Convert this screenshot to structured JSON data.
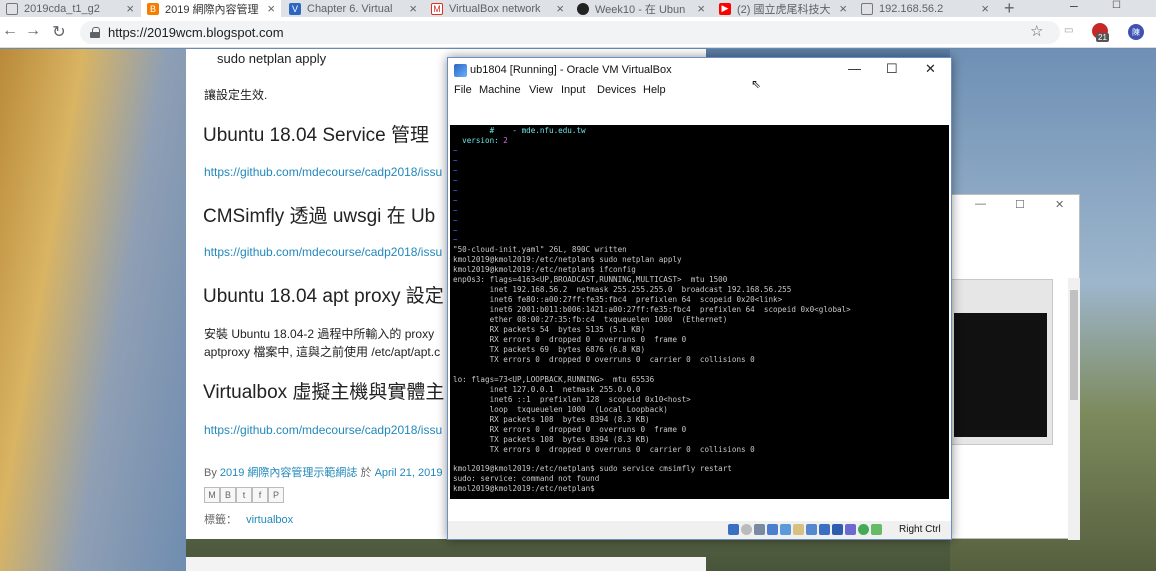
{
  "browser": {
    "tabs": [
      {
        "label": "2019cda_t1_g2",
        "icon": "doc-icon",
        "active": false
      },
      {
        "label": "2019 網際內容管理",
        "icon": "blogger-icon",
        "active": true
      },
      {
        "label": "Chapter 6. Virtual",
        "icon": "vbox-icon",
        "active": false
      },
      {
        "label": "VirtualBox network",
        "icon": "gmail-icon",
        "active": false
      },
      {
        "label": "Week10 - 在 Ubun",
        "icon": "github-icon",
        "active": false
      },
      {
        "label": "(2) 國立虎尾科技大",
        "icon": "youtube-icon",
        "active": false
      },
      {
        "label": "192.168.56.2",
        "icon": "doc-icon",
        "active": false
      }
    ],
    "url": "https://2019wcm.blogspot.com",
    "ext_badge": "21",
    "avatar_letter": "陳"
  },
  "blog": {
    "line1": "sudo netplan apply",
    "line2": "讓設定生效.",
    "h1": "Ubuntu 18.04 Service 管理",
    "link1": "https://github.com/mdecourse/cadp2018/issu",
    "h2": "CMSimfly 透過 uwsgi 在 Ub",
    "link2": "https://github.com/mdecourse/cadp2018/issu",
    "h3": "Ubuntu 18.04 apt proxy 設定",
    "body1": "安裝 Ubuntu 18.04-2 過程中所輸入的 proxy",
    "body2": "aptproxy 檔案中, 這與之前使用 /etc/apt/apt.c",
    "h4": "Virtualbox 虛擬主機與實體主",
    "link3": "https://github.com/mdecourse/cadp2018/issu",
    "byline_by": "By",
    "byline_author": "2019 網際內容管理示範網誌",
    "byline_on": "於",
    "byline_date": "April 21, 2019",
    "labels_prefix": "標籤：",
    "labels_value": "virtualbox"
  },
  "vbox": {
    "title": "ub1804 [Running] - Oracle VM VirtualBox",
    "menu": [
      "File",
      "Machine",
      "View",
      "Input",
      "Devices",
      "Help"
    ],
    "status_text": "Right Ctrl",
    "terminal": [
      "        #    - mde.nfu.edu.tw",
      "  version: 2",
      "~",
      "~",
      "~",
      "~",
      "~",
      "~",
      "~",
      "~",
      "~",
      "~",
      "\"50-cloud-init.yaml\" 26L, 890C written",
      "kmol2019@kmol2019:/etc/netplan$ sudo netplan apply",
      "kmol2019@kmol2019:/etc/netplan$ ifconfig",
      "enp0s3: flags=4163<UP,BROADCAST,RUNNING,MULTICAST>  mtu 1500",
      "        inet 192.168.56.2  netmask 255.255.255.0  broadcast 192.168.56.255",
      "        inet6 fe80::a00:27ff:fe35:fbc4  prefixlen 64  scopeid 0x20<link>",
      "        inet6 2001:b011:b006:1421:a00:27ff:fe35:fbc4  prefixlen 64  scopeid 0x0<global>",
      "        ether 08:00:27:35:fb:c4  txqueuelen 1000  (Ethernet)",
      "        RX packets 54  bytes 5135 (5.1 KB)",
      "        RX errors 0  dropped 0  overruns 0  frame 0",
      "        TX packets 69  bytes 6876 (6.8 KB)",
      "        TX errors 0  dropped 0 overruns 0  carrier 0  collisions 0",
      "",
      "lo: flags=73<UP,LOOPBACK,RUNNING>  mtu 65536",
      "        inet 127.0.0.1  netmask 255.0.0.0",
      "        inet6 ::1  prefixlen 128  scopeid 0x10<host>",
      "        loop  txqueuelen 1000  (Local Loopback)",
      "        RX packets 108  bytes 8394 (8.3 KB)",
      "        RX errors 0  dropped 0  overruns 0  frame 0",
      "        TX packets 108  bytes 8394 (8.3 KB)",
      "        TX errors 0  dropped 0 overruns 0  carrier 0  collisions 0",
      "",
      "kmol2019@kmol2019:/etc/netplan$ sudo service cmsimfly restart",
      "sudo: service: command not found",
      "kmol2019@kmol2019:/etc/netplan$ "
    ]
  },
  "colors": {
    "accent_link": "#2288bb",
    "vbox_border": "#6a8fc7",
    "terminal_bg": "#000000",
    "terminal_fg": "#c8c8c8",
    "terminal_comment": "#6be3e3",
    "terminal_number": "#d86bd8",
    "terminal_tilde": "#4a6fff"
  }
}
